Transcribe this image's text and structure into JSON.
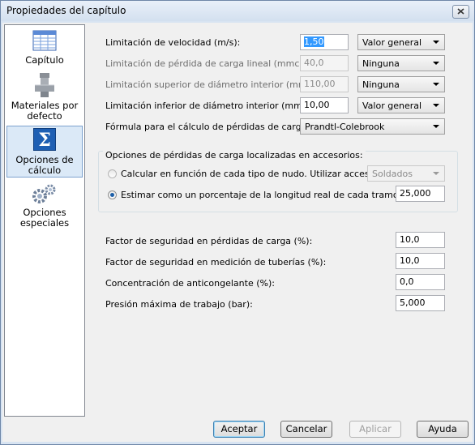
{
  "window": {
    "title": "Propiedades del capítulo"
  },
  "sidebar": {
    "items": [
      {
        "label": "Capítulo",
        "icon": "table-icon"
      },
      {
        "label": "Materiales por defecto",
        "icon": "pipe-fitting-icon"
      },
      {
        "label": "Opciones de cálculo",
        "icon": "sigma-icon",
        "selected": true
      },
      {
        "label": "Opciones especiales",
        "icon": "gears-icon"
      }
    ]
  },
  "limits": {
    "velocity": {
      "label": "Limitación de velocidad (m/s):",
      "value": "1,50",
      "mode": "Valor general"
    },
    "head_loss": {
      "label": "Limitación de pérdida de carga lineal (mmca/m):",
      "value": "40,0",
      "mode": "Ninguna"
    },
    "max_diameter": {
      "label": "Limitación superior de diámetro interior (mm):",
      "value": "110,00",
      "mode": "Ninguna"
    },
    "min_diameter": {
      "label": "Limitación inferior de diámetro interior (mm):",
      "value": "10,00",
      "mode": "Valor general"
    }
  },
  "formula": {
    "label": "Fórmula para el cálculo de pérdidas de carga:",
    "value": "Prandtl-Colebrook"
  },
  "localized": {
    "title": "Opciones de pérdidas de carga localizadas en accesorios:",
    "option1": {
      "label": "Calcular en función de cada tipo de nudo. Utilizar accesorios:",
      "value": "Soldados"
    },
    "option2": {
      "label": "Estimar como un porcentaje de la longitud real de cada tramo (%):",
      "value": "25,000"
    }
  },
  "factors": {
    "safety_head_loss": {
      "label": "Factor de seguridad en pérdidas de carga (%):",
      "value": "10,0"
    },
    "safety_pipe_length": {
      "label": "Factor de seguridad en medición de tuberías (%):",
      "value": "10,0"
    },
    "antifreeze": {
      "label": "Concentración de anticongelante (%):",
      "value": "0,0"
    },
    "max_pressure": {
      "label": "Presión máxima de trabajo (bar):",
      "value": "5,000"
    }
  },
  "buttons": {
    "accept": "Aceptar",
    "cancel": "Cancelar",
    "apply": "Aplicar",
    "help": "Ayuda"
  }
}
